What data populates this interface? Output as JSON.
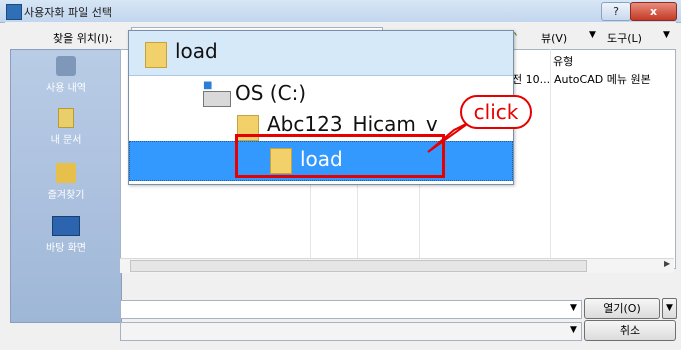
{
  "window": {
    "title": "사용자화 파일 선택",
    "help_label": "?",
    "close_label": "x"
  },
  "toolbar": {
    "lookin_label": "찾을 위치(I):",
    "views_label": "뷰(V)",
    "tools_label": "도구(L)"
  },
  "places": {
    "history": "사용 내역",
    "documents": "내 문서",
    "favorites": "즐겨찾기",
    "desktop": "바탕 화면"
  },
  "filelist": {
    "col_type": "유형",
    "row_date": "전 10...",
    "row_type": "AutoCAD 메뉴 원본"
  },
  "dropdown": {
    "items": [
      "load",
      "OS (C:)",
      "Abc123_Hicam_v",
      "load"
    ],
    "selected_index": 3
  },
  "buttons": {
    "open": "열기(O)",
    "cancel": "취소"
  },
  "annotation": {
    "callout": "click",
    "colors": {
      "highlight": "#e60000",
      "selection": "#3399ff"
    }
  }
}
